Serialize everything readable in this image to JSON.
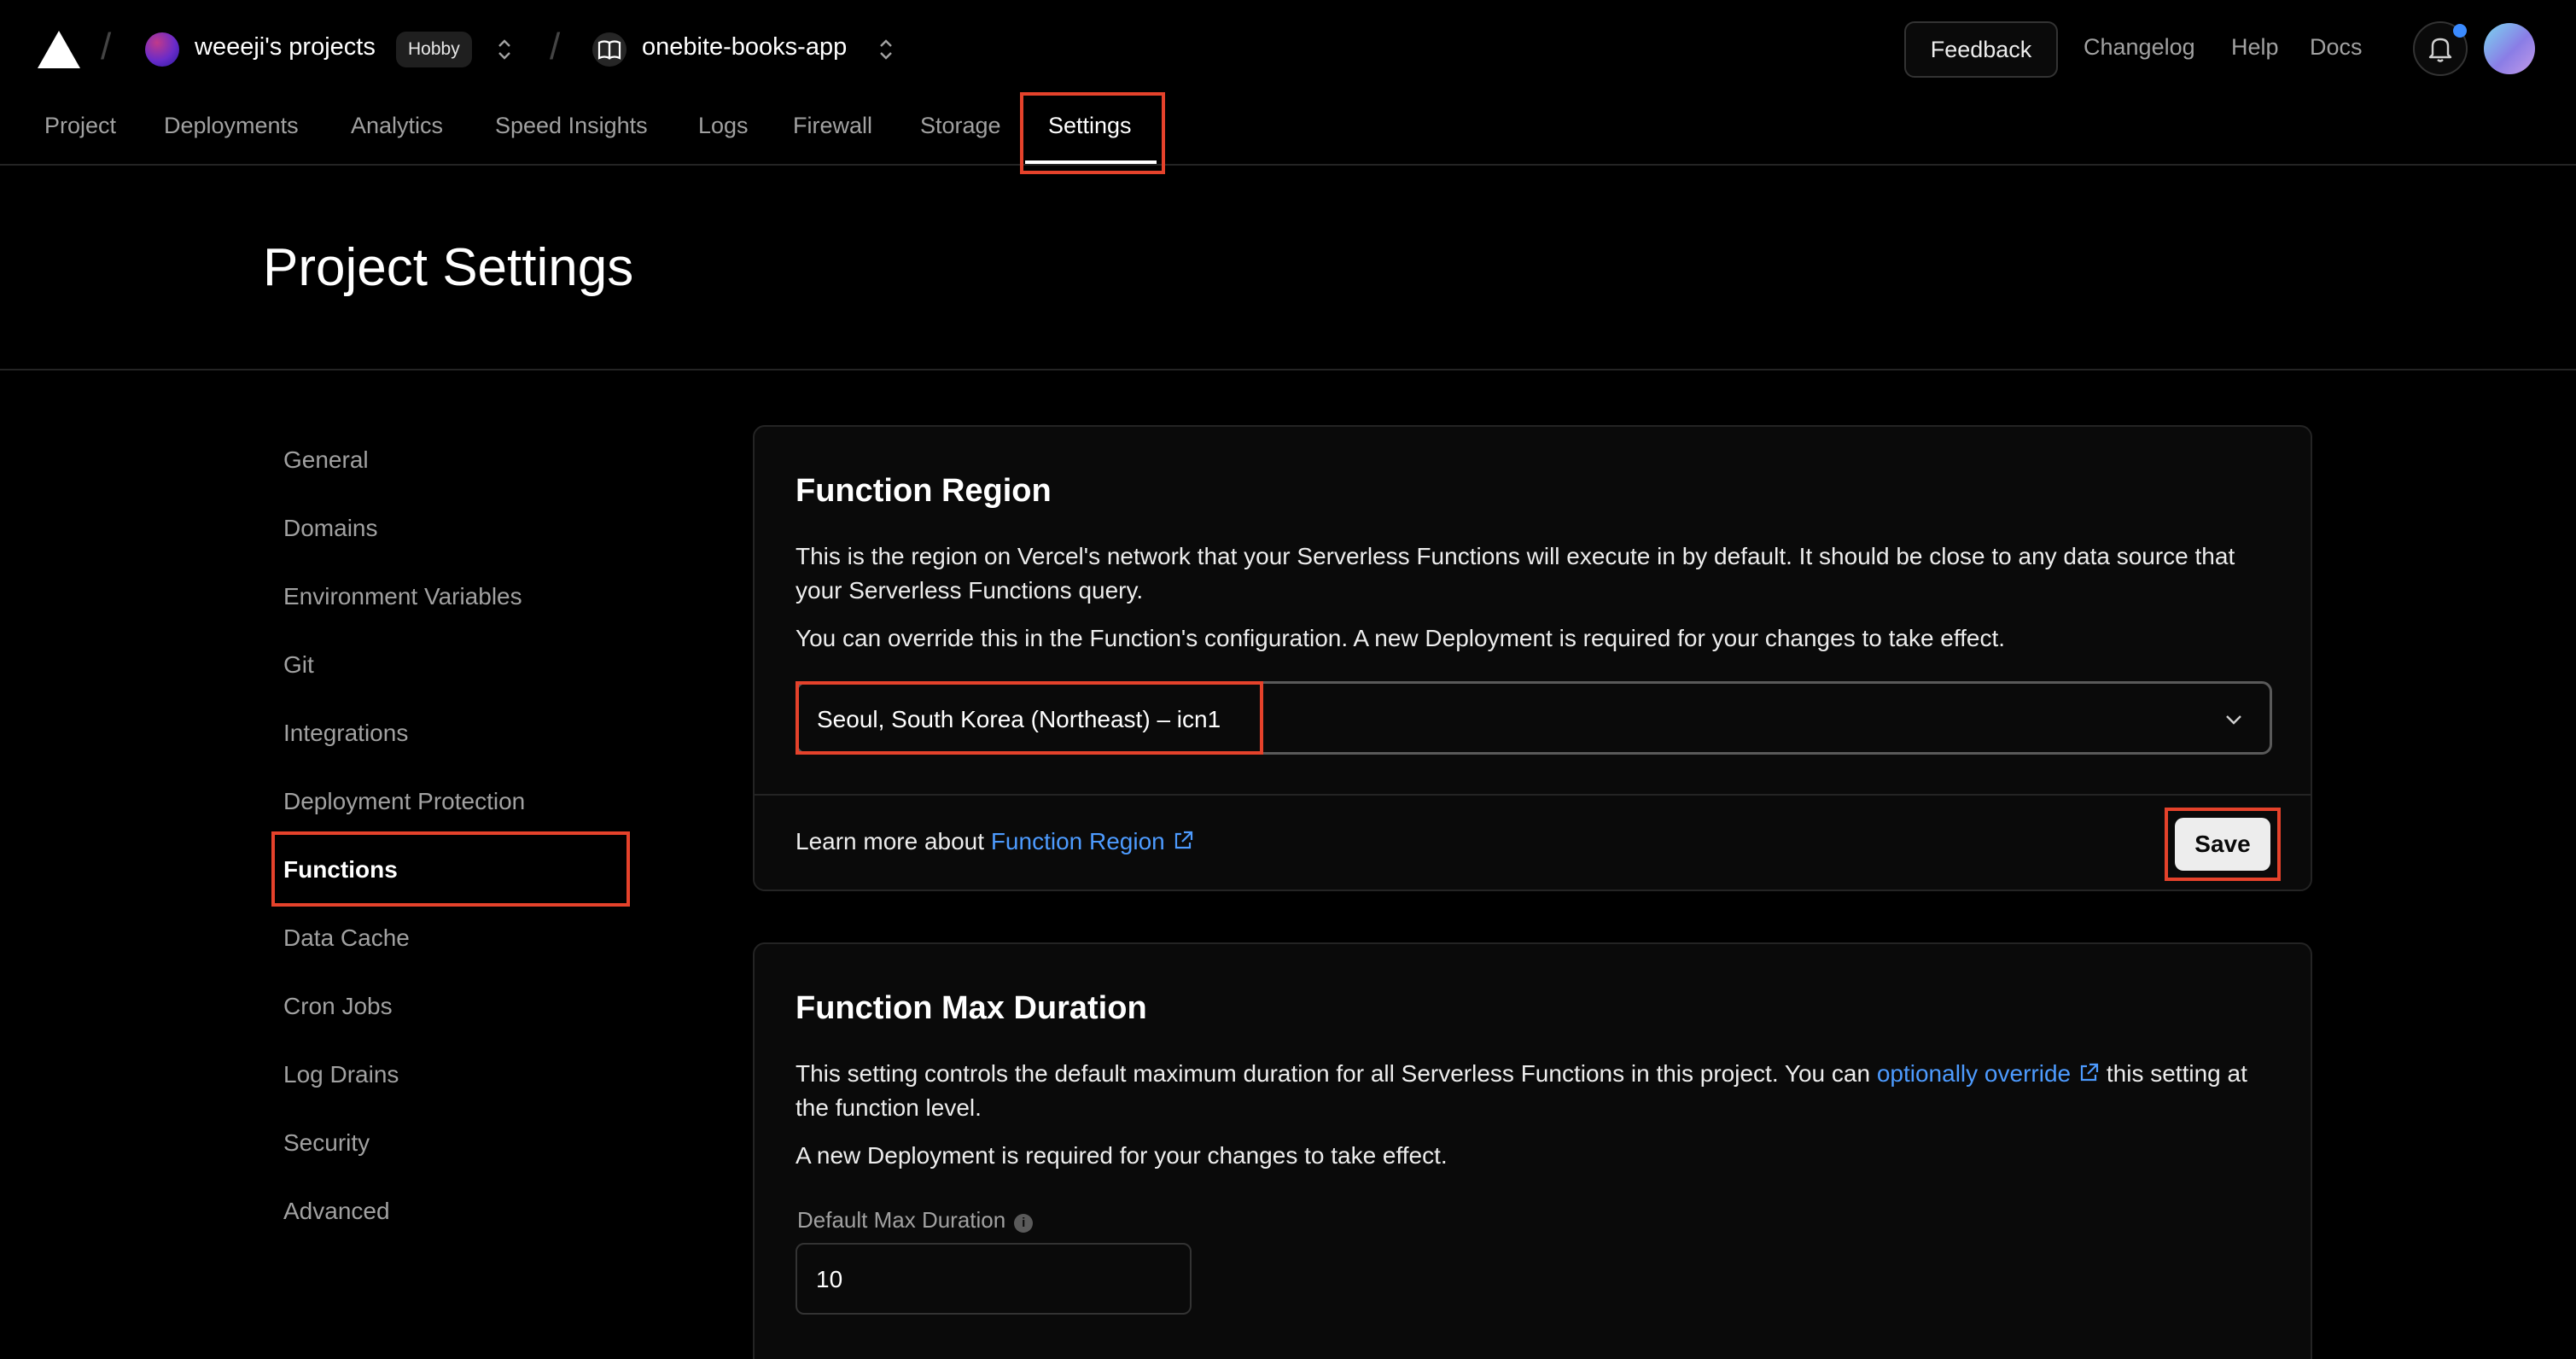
{
  "header": {
    "team_name": "weeeji's projects",
    "plan_badge": "Hobby",
    "project_name": "onebite-books-app",
    "feedback_label": "Feedback",
    "links": [
      "Changelog",
      "Help",
      "Docs"
    ]
  },
  "tabs": [
    "Project",
    "Deployments",
    "Analytics",
    "Speed Insights",
    "Logs",
    "Firewall",
    "Storage",
    "Settings"
  ],
  "active_tab": "Settings",
  "page_title": "Project Settings",
  "sidebar": {
    "items": [
      "General",
      "Domains",
      "Environment Variables",
      "Git",
      "Integrations",
      "Deployment Protection",
      "Functions",
      "Data Cache",
      "Cron Jobs",
      "Log Drains",
      "Security",
      "Advanced"
    ],
    "active": "Functions"
  },
  "function_region": {
    "title": "Function Region",
    "description": "This is the region on Vercel's network that your Serverless Functions will execute in by default. It should be close to any data source that your Serverless Functions query.",
    "note": "You can override this in the Function's configuration. A new Deployment is required for your changes to take effect.",
    "selected_region": "Seoul, South Korea (Northeast) – icn1",
    "learn_more_prefix": "Learn more about",
    "learn_more_link": "Function Region",
    "save_label": "Save"
  },
  "function_max_duration": {
    "title": "Function Max Duration",
    "description_prefix": "This setting controls the default maximum duration for all Serverless Functions in this project. You can",
    "description_link": "optionally override",
    "description_suffix": "this setting at the function level.",
    "note": "A new Deployment is required for your changes to take effect.",
    "field_label": "Default Max Duration",
    "field_value": "10"
  },
  "colors": {
    "background": "#000000",
    "card": "#0a0a0a",
    "link": "#4d9bff",
    "highlight": "#e5422b",
    "notification_dot": "#3b8bff"
  }
}
